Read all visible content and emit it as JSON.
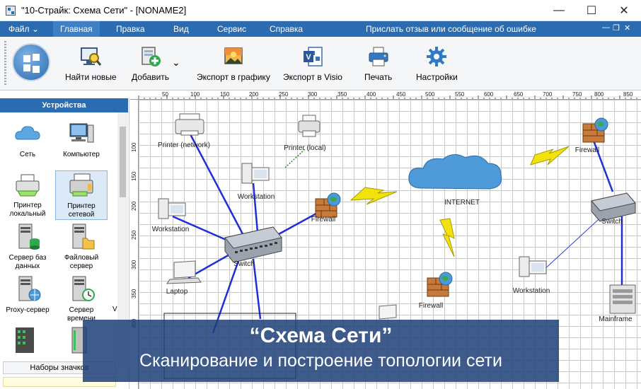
{
  "window": {
    "title": "\"10-Страйк: Схема Сети\" - [NONAME2]"
  },
  "menu": {
    "file": "Файл",
    "items": [
      "Главная",
      "Правка",
      "Вид",
      "Сервис",
      "Справка"
    ],
    "feedback": "Прислать отзыв или сообщение об ошибке"
  },
  "ribbon": {
    "find_new": "Найти новые",
    "add": "Добавить",
    "export_graphic": "Экспорт в графику",
    "export_visio": "Экспорт в Visio",
    "print": "Печать",
    "settings": "Настройки"
  },
  "panel": {
    "header": "Устройства",
    "devices": [
      {
        "label": "Сеть",
        "icon": "cloud-icon"
      },
      {
        "label": "Компьютер",
        "icon": "computer-icon"
      },
      {
        "label": "Принтер локальный",
        "icon": "printer-local-icon"
      },
      {
        "label": "Принтер сетевой",
        "icon": "printer-network-icon"
      },
      {
        "label": "Сервер баз данных",
        "icon": "db-server-icon"
      },
      {
        "label": "Файловый сервер",
        "icon": "file-server-icon"
      },
      {
        "label": "Proxy-сервер",
        "icon": "proxy-server-icon"
      },
      {
        "label": "Сервер времени",
        "icon": "time-server-icon"
      }
    ],
    "footer": "Наборы значков"
  },
  "ruler": {
    "top": [
      "50",
      "100",
      "150",
      "200",
      "250",
      "300",
      "350",
      "400",
      "450",
      "500",
      "550",
      "600",
      "650",
      "700",
      "750",
      "800",
      "850"
    ],
    "left": [
      "100",
      "150",
      "200",
      "250",
      "300",
      "350",
      "400"
    ]
  },
  "diagram": {
    "labels": {
      "printer_network": "Printer (network)",
      "printer_local": "Printer (local)",
      "workstation_top": "Workstation",
      "workstation_left": "Workstation",
      "firewall_mid": "Firewall",
      "switch_main": "Switch",
      "laptop": "Laptop",
      "internet": "INTERNET",
      "firewall_right": "Firewall",
      "switch_right": "Switch",
      "workstation_right": "Workstation",
      "mainframe": "Mainframe",
      "firewall_bottom": "Firewall"
    },
    "colors": {
      "link": "#1f2fd6",
      "cloud": "#4f9ad8",
      "firewall": "#c87a3a",
      "lightning": "#f2e20b"
    }
  },
  "banner": {
    "title": "“Схема Сети”",
    "subtitle": "Сканирование и построение топологии сети"
  }
}
